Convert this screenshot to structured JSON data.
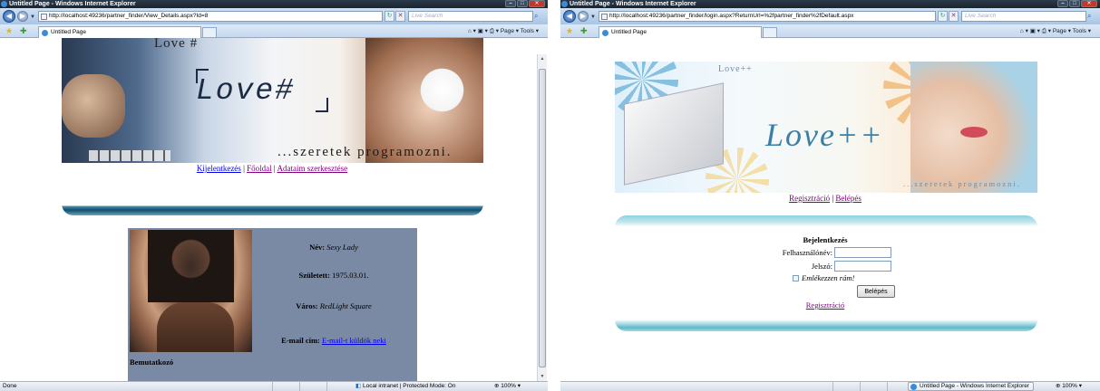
{
  "window1": {
    "title": "Untitled Page - Windows Internet Explorer",
    "url": "http://localhost:49236/partner_finder/View_Details.aspx?Id=8",
    "search_placeholder": "Live Search",
    "tab_label": "Untitled Page",
    "commands": "Page ▾  Tools ▾",
    "banner": {
      "small_title": "Love #",
      "logo": "Love#",
      "tagline": "...szeretek programozni."
    },
    "nav_links": [
      "Kijelentkezés",
      "Főoldal",
      "Adataim szerkesztése"
    ],
    "profile": {
      "name_label": "Név:",
      "name_value": "Sexy Lady",
      "born_label": "Született:",
      "born_value": "1975.03.01.",
      "city_label": "Város:",
      "city_value": "RedLight Square",
      "email_label": "E-mail cím:",
      "email_link": "E-mail-t küldök neki",
      "intro_heading": "Bemutatkozó"
    },
    "status": {
      "text": "Done",
      "zone": "Local intranet | Protected Mode: On",
      "zoom": "100%"
    }
  },
  "window2": {
    "title": "Untitled Page - Windows Internet Explorer",
    "url": "http://localhost:49236/partner_finder/login.aspx?ReturnUrl=%2fpartner_finder%2fDefault.aspx",
    "search_placeholder": "Live Search",
    "tab_label": "Untitled Page",
    "commands": "Page ▾  Tools ▾",
    "banner": {
      "small_title": "Love++",
      "logo": "Love++",
      "tagline": "...szeretek programozni."
    },
    "nav_links": [
      "Regisztráció",
      "Belépés"
    ],
    "login": {
      "title": "Bejelentkezés",
      "username_label": "Felhasználónév:",
      "username_value": "",
      "password_label": "Jelszó:",
      "password_value": "",
      "remember_label": "Emlékezzen rám!",
      "submit_label": "Belépés",
      "register_link": "Regisztráció"
    },
    "status": {
      "taskbar_item": "Untitled Page - Windows Internet Explorer",
      "zoom": "100%"
    }
  },
  "colors": {
    "profile_bg": "#7a8aa4",
    "link": "#0000ee",
    "visited_link": "#800080",
    "bar_dark": "#0e4e70",
    "bar_light": "#5fb8c9"
  }
}
